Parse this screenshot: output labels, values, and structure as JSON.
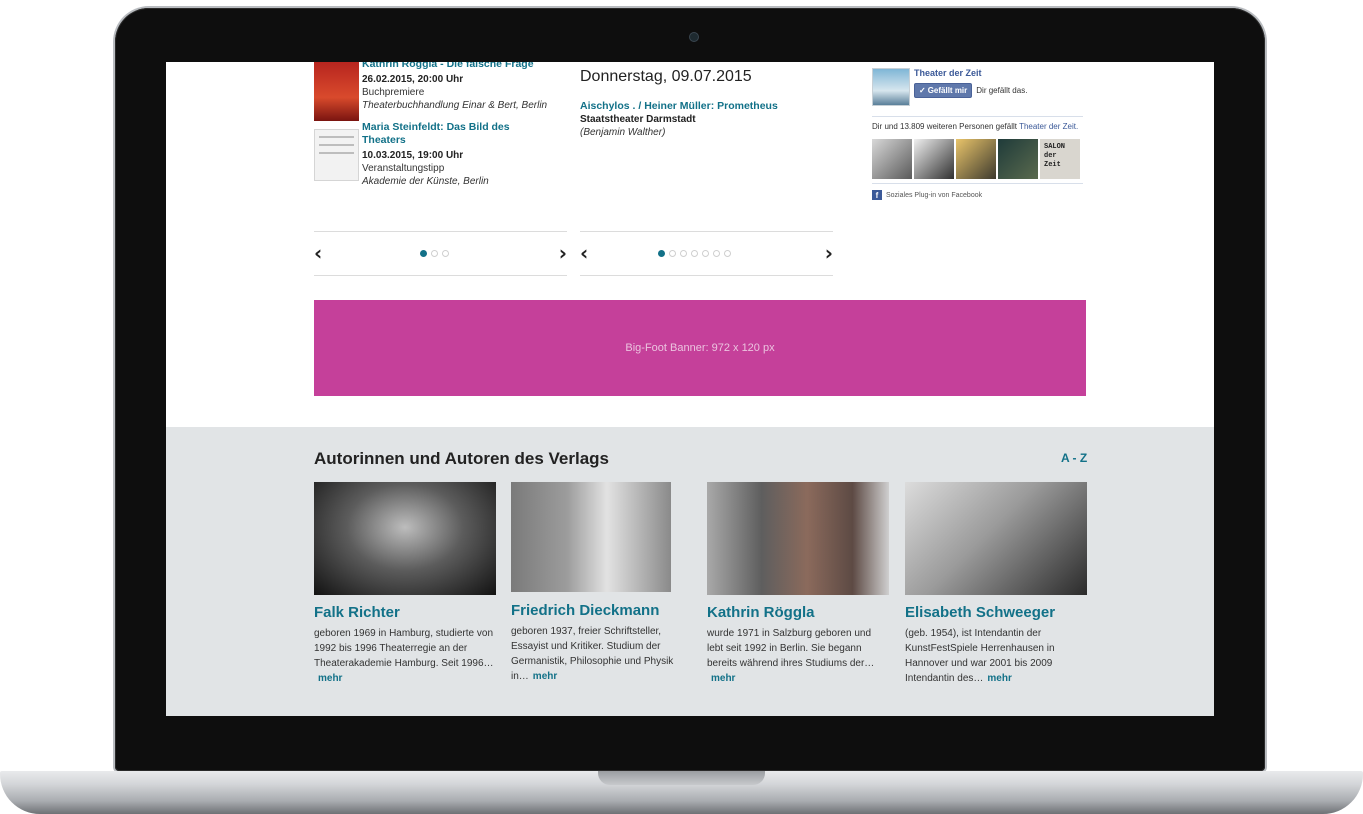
{
  "events_col1": [
    {
      "title": "Kathrin Röggla - Die falsche Frage",
      "date": "26.02.2015, 20:00 Uhr",
      "type": "Buchpremiere",
      "place": "Theaterbuchhandlung Einar & Bert, Berlin"
    },
    {
      "title": "Maria Steinfeldt: Das Bild des Theaters",
      "date": "10.03.2015, 19:00 Uhr",
      "type": "Veranstaltungstipp",
      "place": "Akademie der Künste, Berlin"
    }
  ],
  "events_col2": {
    "heading": "Donnerstag, 09.07.2015",
    "title": "Aischylos . / Heiner Müller: Prometheus",
    "venue": "Staatstheater Darmstadt",
    "person": "(Benjamin Walther)"
  },
  "nav": {
    "prev": "‹",
    "next": "›"
  },
  "facebook": {
    "page_name": "Theater der Zeit",
    "like_button": "Gefällt mir",
    "liked_text": "Dir gefällt das.",
    "count_text": "Dir und 13.809 weiteren Personen gefällt",
    "count_link": "Theater der Zeit.",
    "salon_text": "SALON der Zeit",
    "plugin_text": "Soziales Plug-in von Facebook"
  },
  "banner": {
    "label": "Big-Foot Banner: 972 x 120 px"
  },
  "authors": {
    "heading": "Autorinnen und Autoren des Verlags",
    "az_link": "A - Z",
    "more_label": "mehr",
    "items": [
      {
        "name": "Falk Richter",
        "bio": "geboren 1969 in Hamburg, studierte von 1992 bis 1996 Theaterregie an der Theaterakademie Hamburg. Seit 1996…"
      },
      {
        "name": "Friedrich Dieckmann",
        "bio": "geboren 1937, freier Schriftsteller, Essayist und Kritiker. Studium der Germanistik, Philosophie und Physik in…"
      },
      {
        "name": "Kathrin Röggla",
        "bio": "wurde 1971 in Salzburg geboren und lebt seit 1992 in Berlin. Sie begann bereits während ihres Studiums der…"
      },
      {
        "name": "Elisabeth Schweeger",
        "bio": "(geb. 1954), ist Intendantin der KunstFestSpiele Herrenhausen in Hannover und war 2001 bis 2009 Intendantin des…"
      }
    ]
  },
  "colors": {
    "accent": "#127188",
    "banner": "#c5409a",
    "authors_bg": "#e1e4e6",
    "facebook": "#3b5998"
  }
}
